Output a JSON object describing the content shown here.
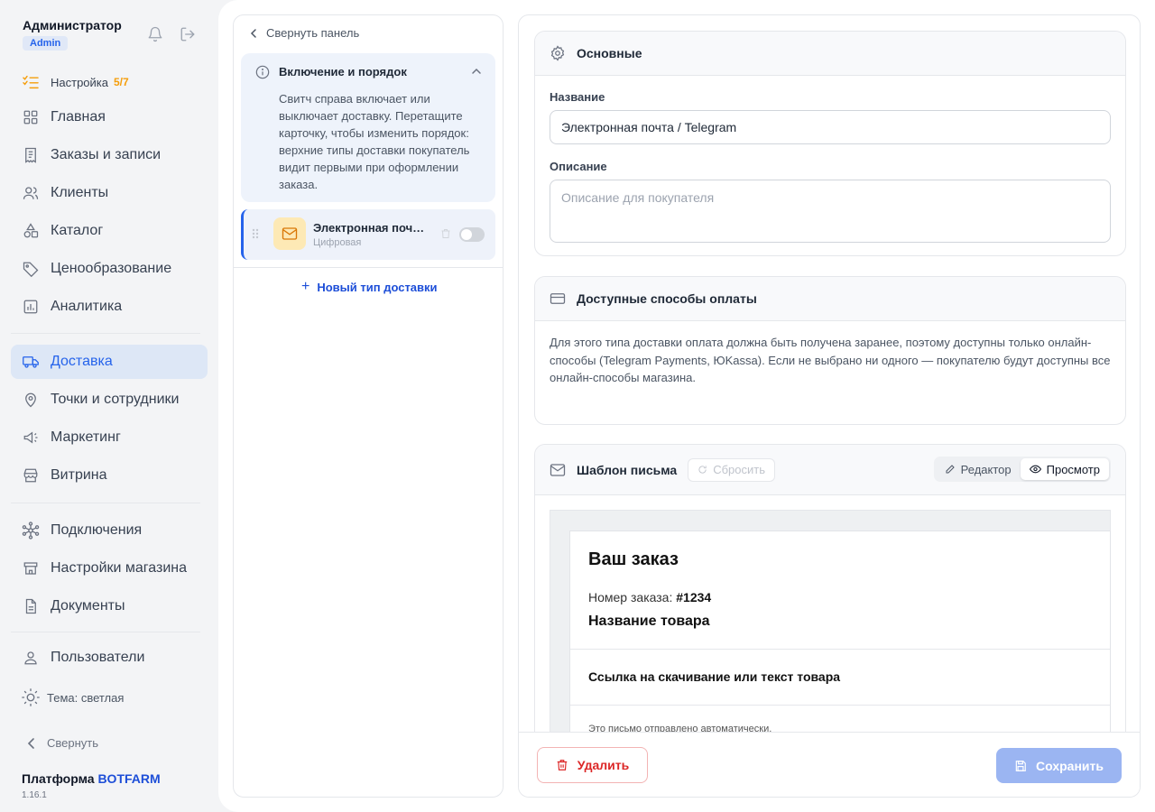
{
  "user": {
    "name": "Администратор",
    "role": "Admin"
  },
  "setup": {
    "label": "Настройка",
    "progress": "5/7"
  },
  "nav": [
    {
      "label": "Главная",
      "icon": "grid-icon"
    },
    {
      "label": "Заказы и записи",
      "icon": "receipt-icon"
    },
    {
      "label": "Клиенты",
      "icon": "users-icon"
    },
    {
      "label": "Каталог",
      "icon": "shapes-icon"
    },
    {
      "label": "Ценообразование",
      "icon": "tag-icon"
    },
    {
      "label": "Аналитика",
      "icon": "chart-icon"
    },
    {
      "label": "Доставка",
      "icon": "truck-icon",
      "active": true
    },
    {
      "label": "Точки и сотрудники",
      "icon": "map-pin-icon"
    },
    {
      "label": "Маркетинг",
      "icon": "megaphone-icon"
    },
    {
      "label": "Витрина",
      "icon": "storefront-icon"
    },
    {
      "label": "Подключения",
      "icon": "network-icon"
    },
    {
      "label": "Настройки магазина",
      "icon": "store-icon"
    },
    {
      "label": "Документы",
      "icon": "document-icon"
    },
    {
      "label": "Пользователи",
      "icon": "user-icon"
    }
  ],
  "theme": {
    "label": "Тема: светлая"
  },
  "collapse": {
    "label": "Свернуть"
  },
  "platform": {
    "prefix": "Платформа",
    "brand": "BOTFARM",
    "version": "1.16.1"
  },
  "list_panel": {
    "collapse_label": "Свернуть панель",
    "info": {
      "title": "Включение и порядок",
      "text": "Свитч справа включает или выключает доставку. Перетащите карточку, чтобы изменить порядок: верхние типы доставки покупатель видит первыми при оформлении заказа."
    },
    "items": [
      {
        "title": "Электронная почта / Telegram",
        "subtitle": "Цифровая",
        "enabled": false
      }
    ],
    "new_label": "Новый тип доставки"
  },
  "basic": {
    "title": "Основные",
    "name_label": "Название",
    "name_value": "Электронная почта / Telegram",
    "desc_label": "Описание",
    "desc_placeholder": "Описание для покупателя"
  },
  "payment": {
    "title": "Доступные способы оплаты",
    "text": "Для этого типа доставки оплата должна быть получена заранее, поэтому доступны только онлайн-способы (Telegram Payments, ЮKassa). Если не выбрано ни одного — покупателю будут доступны все онлайн-способы магазина."
  },
  "template": {
    "title": "Шаблон письма",
    "reset_label": "Сбросить",
    "editor_label": "Редактор",
    "preview_label": "Просмотр",
    "email": {
      "heading": "Ваш заказ",
      "order_prefix": "Номер заказа:",
      "order_number": "#1234",
      "product": "Название товара",
      "link": "Ссылка на скачивание или текст товара",
      "footer": "Это письмо отправлено автоматически."
    }
  },
  "actions": {
    "delete_label": "Удалить",
    "save_label": "Сохранить"
  },
  "colors": {
    "accent": "#2563eb",
    "active_bg": "#dde7f6",
    "danger": "#dc2626",
    "warning": "#f59e0b"
  }
}
